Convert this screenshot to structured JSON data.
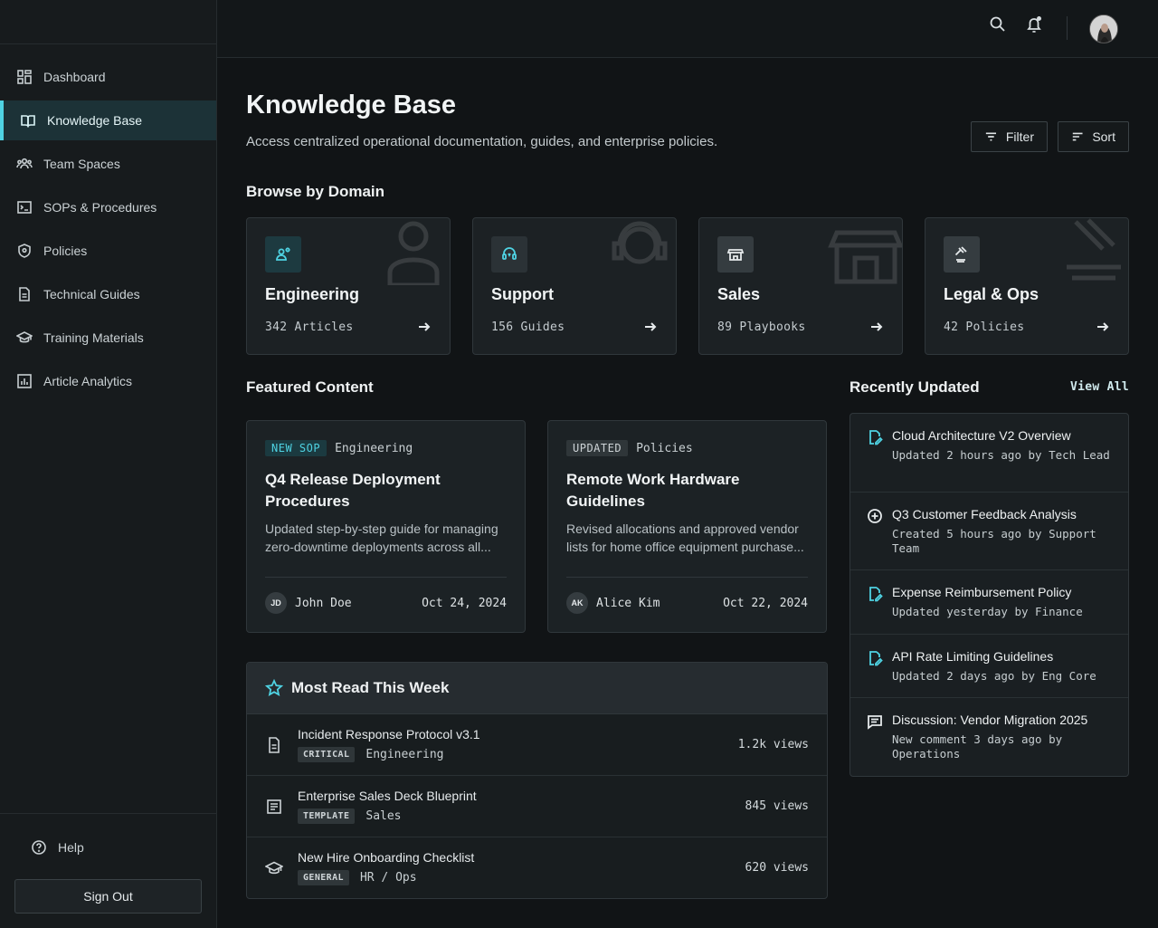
{
  "sidebar": {
    "items": [
      {
        "label": "Dashboard",
        "icon": "dashboard-icon"
      },
      {
        "label": "Knowledge Base",
        "icon": "book-icon"
      },
      {
        "label": "Team Spaces",
        "icon": "team-icon"
      },
      {
        "label": "SOPs & Procedures",
        "icon": "terminal-icon"
      },
      {
        "label": "Policies",
        "icon": "shield-icon"
      },
      {
        "label": "Technical Guides",
        "icon": "document-icon"
      },
      {
        "label": "Training Materials",
        "icon": "graduation-cap-icon"
      },
      {
        "label": "Article Analytics",
        "icon": "analytics-icon"
      }
    ],
    "active_index": 1,
    "help_label": "Help",
    "signout_label": "Sign Out"
  },
  "header": {
    "title": "Knowledge Base",
    "subtitle": "Access centralized operational documentation, guides, and enterprise policies.",
    "filter_label": "Filter",
    "sort_label": "Sort"
  },
  "domains": {
    "title": "Browse by Domain",
    "items": [
      {
        "name": "Engineering",
        "count": "342 Articles",
        "accent": "#4fd3e3",
        "icon_bg": "#1d3a40"
      },
      {
        "name": "Support",
        "count": "156 Guides",
        "accent": "#4fd3e3",
        "icon_bg": "#2b3236"
      },
      {
        "name": "Sales",
        "count": "89 Playbooks",
        "accent": "#e6eaec",
        "icon_bg": "#353c40"
      },
      {
        "name": "Legal & Ops",
        "count": "42 Policies",
        "accent": "#e6eaec",
        "icon_bg": "#353c40"
      }
    ]
  },
  "featured": {
    "title": "Featured Content",
    "items": [
      {
        "badge": "NEW SOP",
        "badge_color": "#4fd3e3",
        "badge_bg": "#1b3a40",
        "category": "Engineering",
        "title": "Q4 Release Deployment Procedures",
        "desc": "Updated step-by-step guide for managing zero-downtime deployments across all...",
        "initials": "JD",
        "author": "John Doe",
        "date": "Oct 24, 2024"
      },
      {
        "badge": "UPDATED",
        "badge_color": "#cdd3d6",
        "badge_bg": "#2f3639",
        "category": "Policies",
        "title": "Remote Work Hardware Guidelines",
        "desc": "Revised allocations and approved vendor lists for home office equipment purchase...",
        "initials": "AK",
        "author": "Alice Kim",
        "date": "Oct 22, 2024"
      }
    ]
  },
  "most_read": {
    "title": "Most Read This Week",
    "items": [
      {
        "title": "Incident Response Protocol v3.1",
        "tag": "CRITICAL",
        "category": "Engineering",
        "views": "1.2k views",
        "icon": "document-icon"
      },
      {
        "title": "Enterprise Sales Deck Blueprint",
        "tag": "TEMPLATE",
        "category": "Sales",
        "views": "845 views",
        "icon": "list-document-icon"
      },
      {
        "title": "New Hire Onboarding Checklist",
        "tag": "GENERAL",
        "category": "HR / Ops",
        "views": "620 views",
        "icon": "graduation-cap-icon"
      }
    ]
  },
  "recent": {
    "title": "Recently Updated",
    "view_all": "View All",
    "items": [
      {
        "title": "Cloud Architecture V2 Overview",
        "sub": "Updated 2 hours ago by Tech Lead",
        "icon": "edit-document-icon",
        "color": "#4fd3e3"
      },
      {
        "title": "Q3 Customer Feedback Analysis",
        "sub": "Created 5 hours ago by Support Team",
        "icon": "add-circle-icon",
        "color": "#e6eaec"
      },
      {
        "title": "Expense Reimbursement Policy",
        "sub": "Updated yesterday by Finance",
        "icon": "edit-document-icon",
        "color": "#4fd3e3"
      },
      {
        "title": "API Rate Limiting Guidelines",
        "sub": "Updated 2 days ago by Eng Core",
        "icon": "edit-document-icon",
        "color": "#4fd3e3"
      },
      {
        "title": "Discussion: Vendor Migration 2025",
        "sub": "New comment 3 days ago by Operations",
        "icon": "comment-icon",
        "color": "#e6eaec"
      }
    ]
  }
}
